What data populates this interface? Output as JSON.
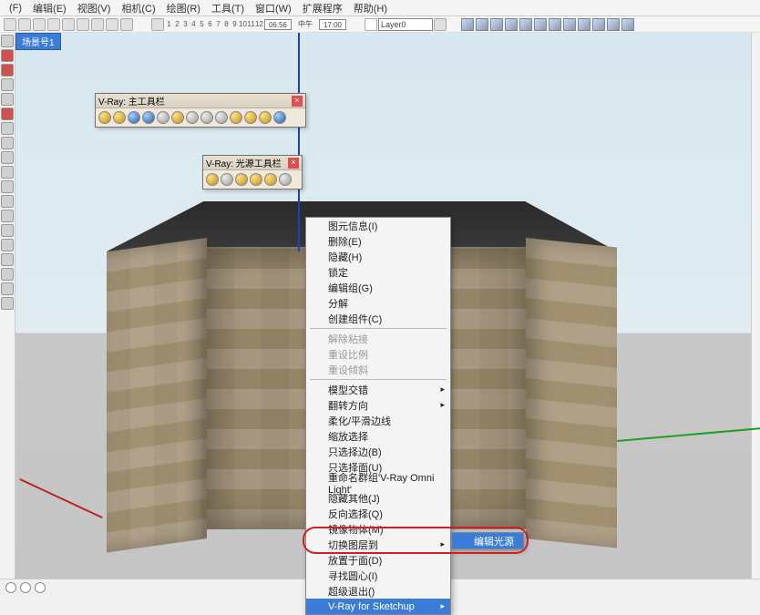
{
  "menubar": {
    "items": [
      "(F)",
      "编辑(E)",
      "视图(V)",
      "相机(C)",
      "绘图(R)",
      "工具(T)",
      "窗口(W)",
      "扩展程序",
      "帮助(H)"
    ]
  },
  "scene_tab": "场景号1",
  "top_toolbar": {
    "digits": [
      "1",
      "2",
      "3",
      "4",
      "5",
      "6",
      "7",
      "8",
      "9",
      "10",
      "11",
      "12"
    ],
    "time1": "06:56",
    "midlabel": "中午",
    "time2": "17:00",
    "layer": "Layer0"
  },
  "panels": {
    "main": {
      "title": "V-Ray: 主工具栏"
    },
    "light": {
      "title": "V-Ray: 光源工具栏"
    }
  },
  "context": {
    "items": [
      {
        "label": "图元信息(I)"
      },
      {
        "label": "删除(E)"
      },
      {
        "label": "隐藏(H)"
      },
      {
        "label": "锁定"
      },
      {
        "label": "编辑组(G)"
      },
      {
        "label": "分解"
      },
      {
        "label": "创建组件(C)"
      },
      {
        "sep": true
      },
      {
        "label": "解除粘接",
        "disabled": true
      },
      {
        "label": "重设比例",
        "disabled": true
      },
      {
        "label": "重设倾斜",
        "disabled": true
      },
      {
        "sep": true
      },
      {
        "label": "模型交错",
        "sub": true
      },
      {
        "label": "翻转方向",
        "sub": true
      },
      {
        "label": "柔化/平滑边线"
      },
      {
        "label": "缩放选择"
      },
      {
        "label": "只选择边(B)"
      },
      {
        "label": "只选择面(U)"
      },
      {
        "label": "重命名群组'V-Ray Omni Light'"
      },
      {
        "label": "隐藏其他(J)"
      },
      {
        "label": "反向选择(Q)"
      },
      {
        "label": "镜像物体(M)"
      },
      {
        "label": "切换图层到",
        "sub": true
      },
      {
        "label": "放置于面(D)"
      },
      {
        "label": "寻找圆心(I)"
      },
      {
        "label": "超级退出()"
      },
      {
        "label": "V-Ray for Sketchup",
        "sub": true,
        "hl": true
      }
    ],
    "submenu_label": "编辑光源"
  }
}
